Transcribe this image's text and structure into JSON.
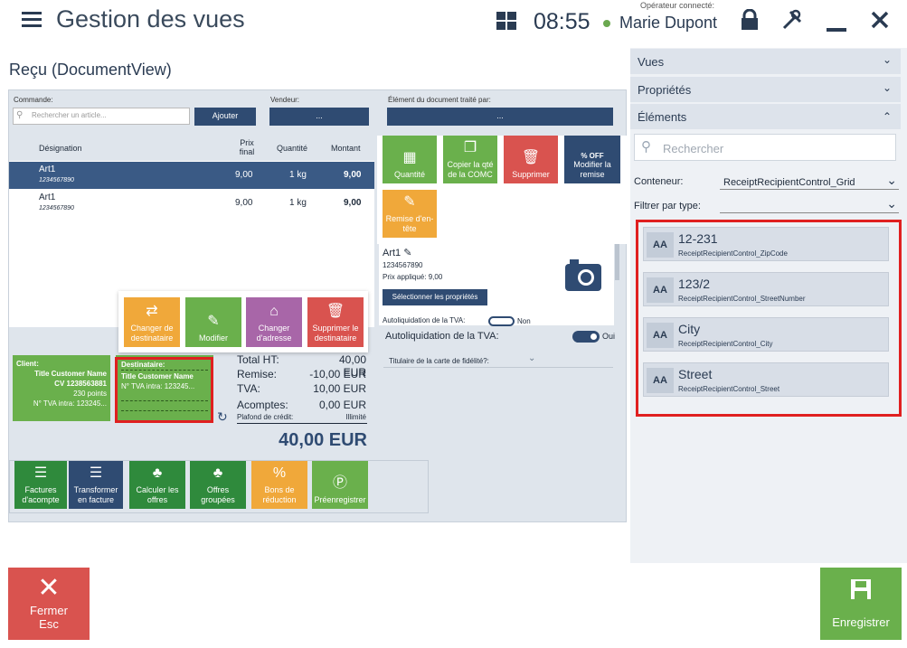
{
  "header": {
    "title": "Gestion des vues",
    "time": "08:55",
    "operator_label": "Opérateur connecté:",
    "operator_name": "Marie Dupont"
  },
  "document_title": "Reçu (DocumentView)",
  "order": {
    "commande_label": "Commande:",
    "search_placeholder": "Rechercher un article...",
    "add_label": "Ajouter",
    "vendeur_label": "Vendeur:",
    "vendeur_value": "...",
    "element_label": "Élément du document traité par:",
    "element_value": "..."
  },
  "table": {
    "headers": {
      "designation": "Désignation",
      "prix": "Prix final",
      "quantite": "Quantité",
      "montant": "Montant"
    },
    "rows": [
      {
        "name": "Art1",
        "code": "1234567890",
        "price": "9,00",
        "qty": "1 kg",
        "amount": "9,00"
      },
      {
        "name": "Art1",
        "code": "1234567890",
        "price": "9,00",
        "qty": "1 kg",
        "amount": "9,00"
      }
    ]
  },
  "actions": {
    "quantite": "Quantité",
    "copier": "Copier la qté de la COMC",
    "supprimer": "Supprimer",
    "modifier_remise": "Modifier la remise",
    "off_text": "% OFF",
    "remise_entete": "Remise d'en-tête"
  },
  "item_detail": {
    "name": "Art1",
    "code": "1234567890",
    "price": "Prix appliqué: 9,00",
    "select_props": "Sélectionner les propriétés",
    "autoliq_label": "Autoliquidation de la TVA:",
    "autoliq_value": "Non",
    "autoliq2_label": "Autoliquidation de la TVA:",
    "autoliq2_value": "Oui",
    "fidelite_label": "Titulaire de la carte de fidélité?:"
  },
  "popup": {
    "changer_dest": "Changer de destinataire",
    "modifier": "Modifier",
    "changer_adresse": "Changer d'adresse",
    "supprimer_dest": "Supprimer le destinataire"
  },
  "client": {
    "label": "Client:",
    "name": "Title Customer Name",
    "cv": "CV 1238563881",
    "points": "230 points",
    "tva": "N° TVA intra: 123245..."
  },
  "destinataire": {
    "label": "Destinataire:",
    "name": "Title Customer Name",
    "tva": "N° TVA intra: 123245..."
  },
  "totals": {
    "ht_label": "Total HT:",
    "ht": "40,00 EUR",
    "remise_label": "Remise:",
    "remise": "-10,00 EUR",
    "tva_label": "TVA:",
    "tva": "10,00 EUR",
    "acomptes_label": "Acomptes:",
    "acomptes": "0,00 EUR",
    "plafond_label": "Plafond de crédit:",
    "plafond": "Illimité",
    "total": "40,00 EUR"
  },
  "bottom_tiles": {
    "factures": "Factures d'acompte",
    "transformer": "Transformer en facture",
    "calculer": "Calculer les offres",
    "offres": "Offres groupées",
    "bons": "Bons de réduction",
    "preenregistrer": "Préenregistrer"
  },
  "right_panel": {
    "vues": "Vues",
    "proprietes": "Propriétés",
    "elements": "Éléments",
    "search_placeholder": "Rechercher",
    "conteneur_label": "Conteneur:",
    "conteneur_value": "ReceiptRecipientControl_Grid",
    "filtrer_label": "Filtrer par type:",
    "items": [
      {
        "value": "12-231",
        "name": "ReceiptRecipientControl_ZipCode"
      },
      {
        "value": "123/2",
        "name": "ReceiptRecipientControl_StreetNumber"
      },
      {
        "value": "City",
        "name": "ReceiptRecipientControl_City"
      },
      {
        "value": "Street",
        "name": "ReceiptRecipientControl_Street"
      }
    ]
  },
  "footer": {
    "fermer": "Fermer",
    "esc": "Esc",
    "enregistrer": "Enregistrer"
  },
  "colors": {
    "navy": "#2f4b72",
    "green": "#6ab04c",
    "red": "#d9534f",
    "orange": "#f0a83a",
    "highlight": "#e02020"
  }
}
